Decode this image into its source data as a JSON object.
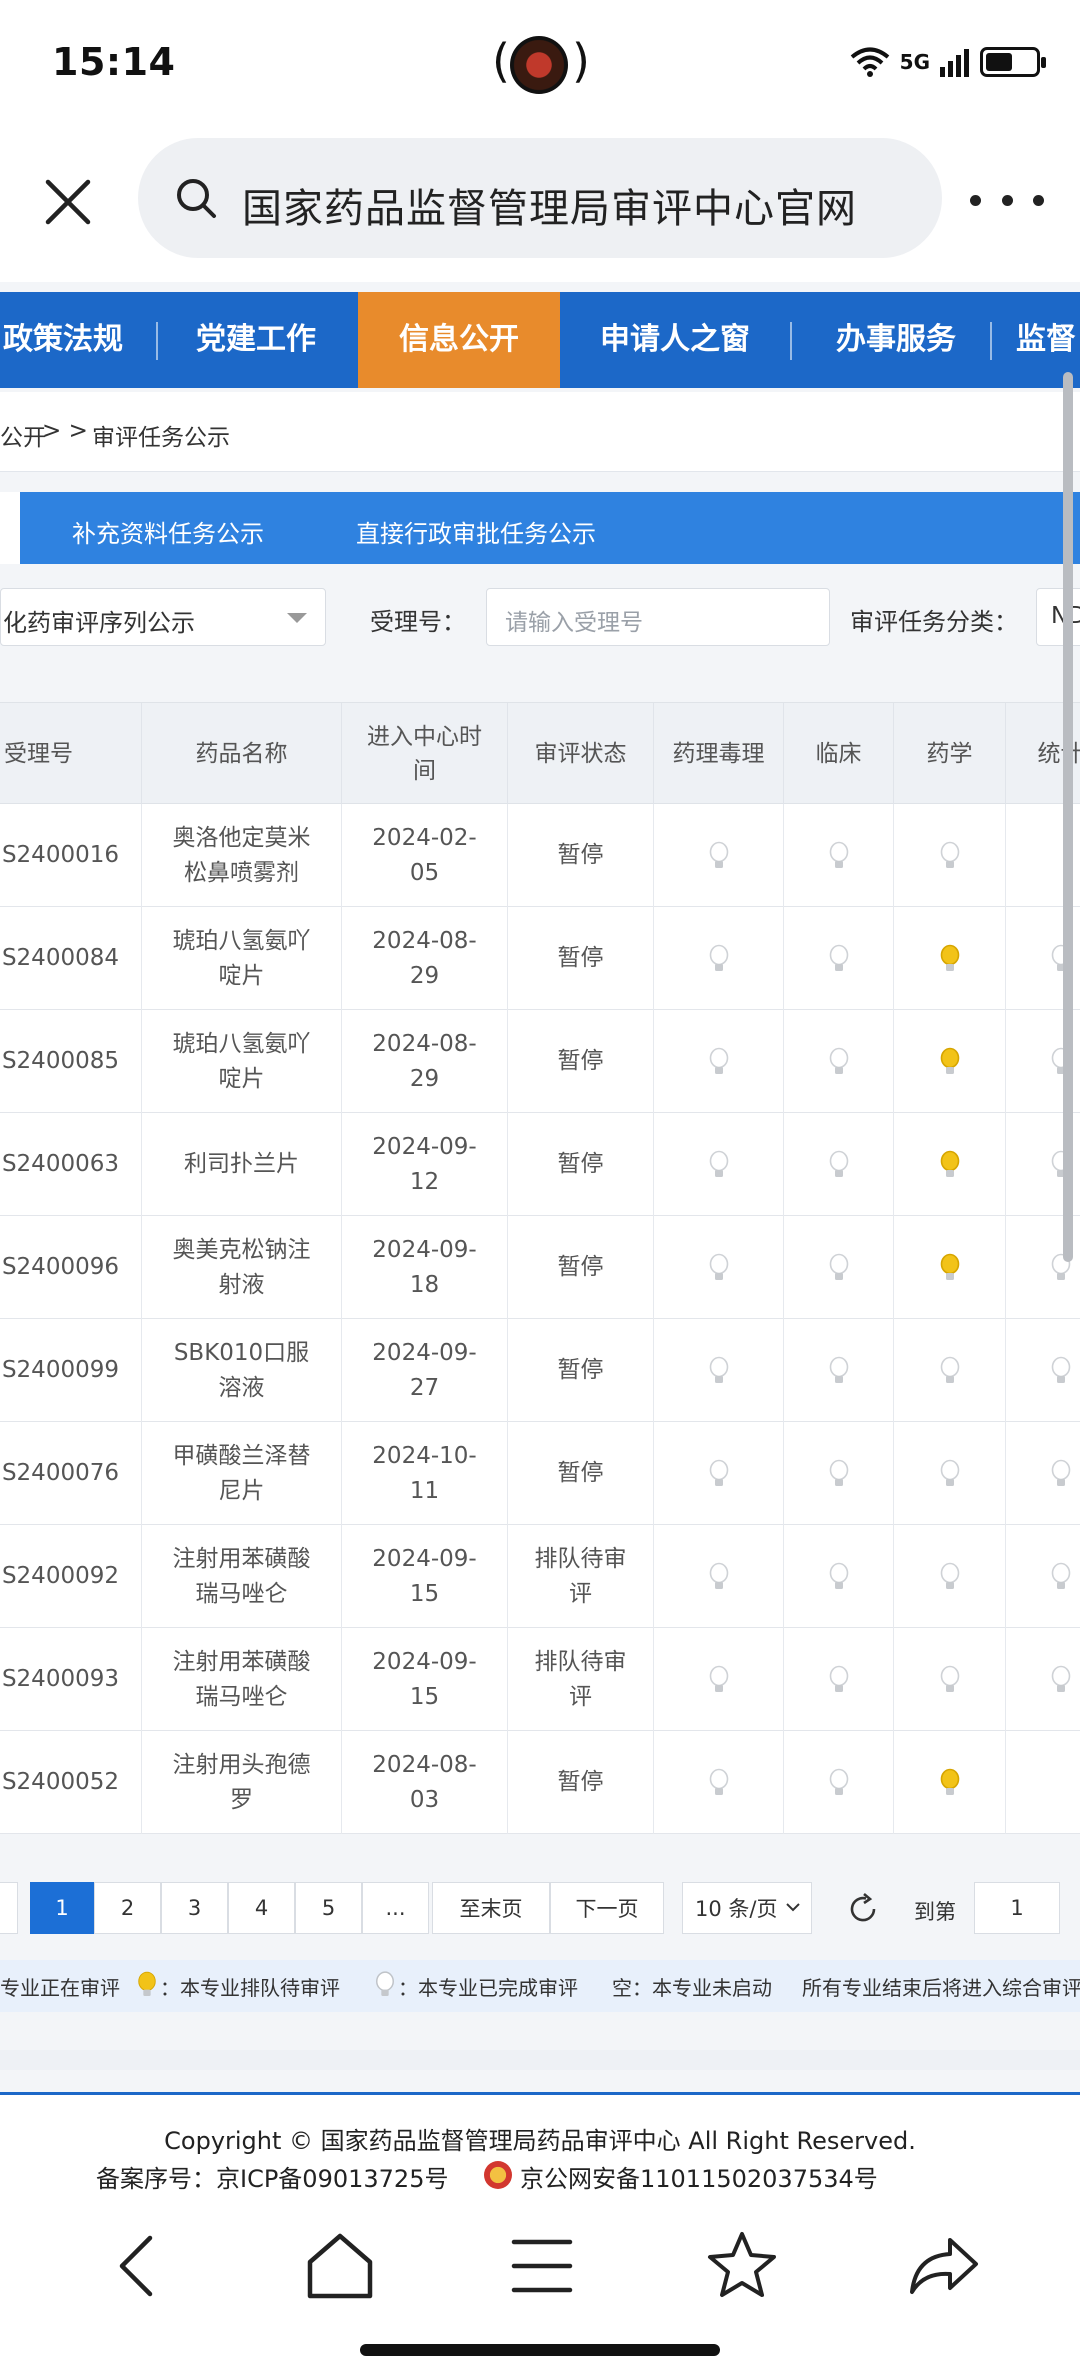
{
  "status_bar": {
    "time": "15:14",
    "network": "5G",
    "battery_level": 0.55
  },
  "browser": {
    "address_text": "国家药品监督管理局审评中心官网"
  },
  "nav": {
    "items": [
      {
        "label": "政策法规",
        "active": false
      },
      {
        "label": "党建工作",
        "active": false
      },
      {
        "label": "信息公开",
        "active": true
      },
      {
        "label": "申请人之窗",
        "active": false
      },
      {
        "label": "办事服务",
        "active": false
      },
      {
        "label": "监督",
        "active": false
      }
    ]
  },
  "breadcrumb": {
    "parent": "公开",
    "separator": "> >",
    "current": "审评任务公示"
  },
  "subtabs": {
    "items": [
      "补充资料任务公示",
      "直接行政审批任务公示"
    ]
  },
  "filters": {
    "sequence_value": "化药审评序列公示",
    "accept_no_label": "受理号：",
    "accept_no_placeholder": "请输入受理号",
    "task_type_label": "审评任务分类：",
    "task_type_value": "ND"
  },
  "table": {
    "headers": [
      "受理号",
      "药品名称",
      "进入中心时间",
      "审评状态",
      "药理毒理",
      "临床",
      "药学",
      "统计"
    ],
    "rows": [
      {
        "id": "S2400016",
        "name": "奥洛他定莫米松鼻喷雾剂",
        "date": "2024-02-05",
        "status": "暂停",
        "pharm": "done",
        "clin": "done",
        "chem": "done",
        "stat": "none"
      },
      {
        "id": "S2400084",
        "name": "琥珀八氢氨吖啶片",
        "date": "2024-08-29",
        "status": "暂停",
        "pharm": "done",
        "clin": "done",
        "chem": "queue",
        "stat": "done"
      },
      {
        "id": "S2400085",
        "name": "琥珀八氢氨吖啶片",
        "date": "2024-08-29",
        "status": "暂停",
        "pharm": "done",
        "clin": "done",
        "chem": "queue",
        "stat": "done"
      },
      {
        "id": "S2400063",
        "name": "利司扑兰片",
        "date": "2024-09-12",
        "status": "暂停",
        "pharm": "done",
        "clin": "done",
        "chem": "queue",
        "stat": "done"
      },
      {
        "id": "S2400096",
        "name": "奥美克松钠注射液",
        "date": "2024-09-18",
        "status": "暂停",
        "pharm": "done",
        "clin": "done",
        "chem": "queue",
        "stat": "done"
      },
      {
        "id": "S2400099",
        "name": "SBK010口服溶液",
        "date": "2024-09-27",
        "status": "暂停",
        "pharm": "done",
        "clin": "done",
        "chem": "done",
        "stat": "done"
      },
      {
        "id": "S2400076",
        "name": "甲磺酸兰泽替尼片",
        "date": "2024-10-11",
        "status": "暂停",
        "pharm": "done",
        "clin": "done",
        "chem": "done",
        "stat": "done"
      },
      {
        "id": "S2400092",
        "name": "注射用苯磺酸瑞马唑仑",
        "date": "2024-09-15",
        "status": "排队待审评",
        "pharm": "done",
        "clin": "done",
        "chem": "done",
        "stat": "done"
      },
      {
        "id": "S2400093",
        "name": "注射用苯磺酸瑞马唑仑",
        "date": "2024-09-15",
        "status": "排队待审评",
        "pharm": "done",
        "clin": "done",
        "chem": "done",
        "stat": "done"
      },
      {
        "id": "S2400052",
        "name": "注射用头孢德罗",
        "date": "2024-08-03",
        "status": "暂停",
        "pharm": "done",
        "clin": "done",
        "chem": "queue",
        "stat": "none"
      }
    ]
  },
  "pagination": {
    "pages": [
      "1",
      "2",
      "3",
      "4",
      "5",
      "..."
    ],
    "current": "1",
    "last_label": "至末页",
    "next_label": "下一页",
    "page_size_label": "10 条/页",
    "goto_label": "到第",
    "goto_value": "1"
  },
  "legend": {
    "item1": "专业正在审评",
    "item2": "：本专业排队待审评",
    "item3": "：本专业已完成审评",
    "item4": "空：本专业未启动",
    "item5": "所有专业结束后将进入综合审评"
  },
  "footer": {
    "copyright": "Copyright © 国家药品监督管理局药品审评中心   All Right Reserved.",
    "icp": "备案序号：京ICP备09013725号",
    "police": "京公网安备11011502037534号"
  },
  "colors": {
    "nav_blue": "#1c68c8",
    "active_orange": "#e88b2c",
    "subtab_blue": "#2f82e0",
    "bulb_yellow": "#f2c318",
    "bulb_gray": "#cfd2d6"
  }
}
